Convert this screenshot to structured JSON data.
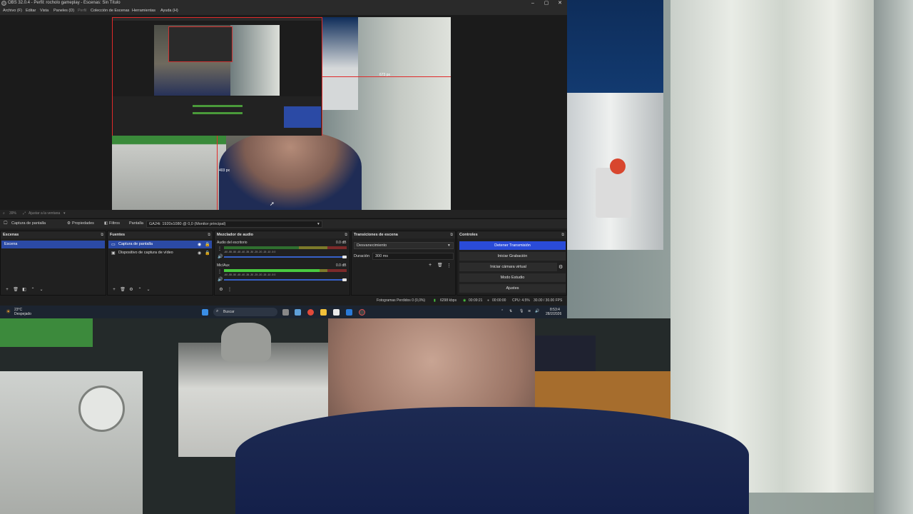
{
  "window": {
    "title": "OBS 32.0.4 - Perfil: rocholo gameplay - Escenas: Sin Título",
    "minimize": "‒",
    "maximize": "▢",
    "close": "✕"
  },
  "menu": {
    "items": [
      "Archivo (F)",
      "Editar",
      "Vista",
      "Paneles (D)",
      "Perfil",
      "Colección de Escenas",
      "Herramientas",
      "Ayuda (H)"
    ]
  },
  "preview": {
    "zoom": "39%",
    "fit_label": "Ajustar a la ventana",
    "dimension_top": "673 px",
    "dimension_left": "403 px"
  },
  "source_bar": {
    "source_name": "Captura de pantalla",
    "properties": "Propiedades",
    "filters": "Filtros",
    "display_label": "Pantalla",
    "display_value": "GA24i: 1920x1080 @ 0,0 (Monitor principal)"
  },
  "scenes": {
    "title": "Escenas",
    "items": [
      {
        "label": "Escena"
      }
    ]
  },
  "sources": {
    "title": "Fuentes",
    "items": [
      {
        "label": "Captura de pantalla"
      },
      {
        "label": "Dispositivo de captura de vídeo"
      }
    ]
  },
  "mixer": {
    "title": "Mezclador de audio",
    "channels": [
      {
        "name": "Audio del escritorio",
        "db": "0.0 dB",
        "level": 0.0
      },
      {
        "name": "Mic/Aux",
        "db": "0.0 dB",
        "level": 0.78
      }
    ],
    "ticks": "-60 -55 -50 -45 -40 -35 -30 -25 -20 -15 -10 -5 0"
  },
  "transitions": {
    "title": "Transiciones de escena",
    "selected": "Desvanecimiento",
    "duration_label": "Duración",
    "duration_value": "300 ms"
  },
  "controls": {
    "title": "Controles",
    "buttons": [
      "Detener Transmisión",
      "Iniciar Grabación",
      "Iniciar cámara virtual",
      "Modo Estudio",
      "Ajustes"
    ]
  },
  "status": {
    "dropped": "Fotogramas Perdidos 0 (0,0%)",
    "bitrate": "6298 kbps",
    "live_time": "00:09:21",
    "rec_time": "00:00:00",
    "cpu": "CPU: 4.5%",
    "fps": "30.00 / 30.00 FPS"
  },
  "taskbar": {
    "weather_temp": "23°C",
    "weather_text": "Despejado",
    "search": "Buscar",
    "time": "8:53:4",
    "date": "28/2/2026"
  },
  "colors": {
    "accent": "#2b4aa5",
    "stream_button": "#2a4bd8",
    "meter_green": "#49c93f"
  }
}
